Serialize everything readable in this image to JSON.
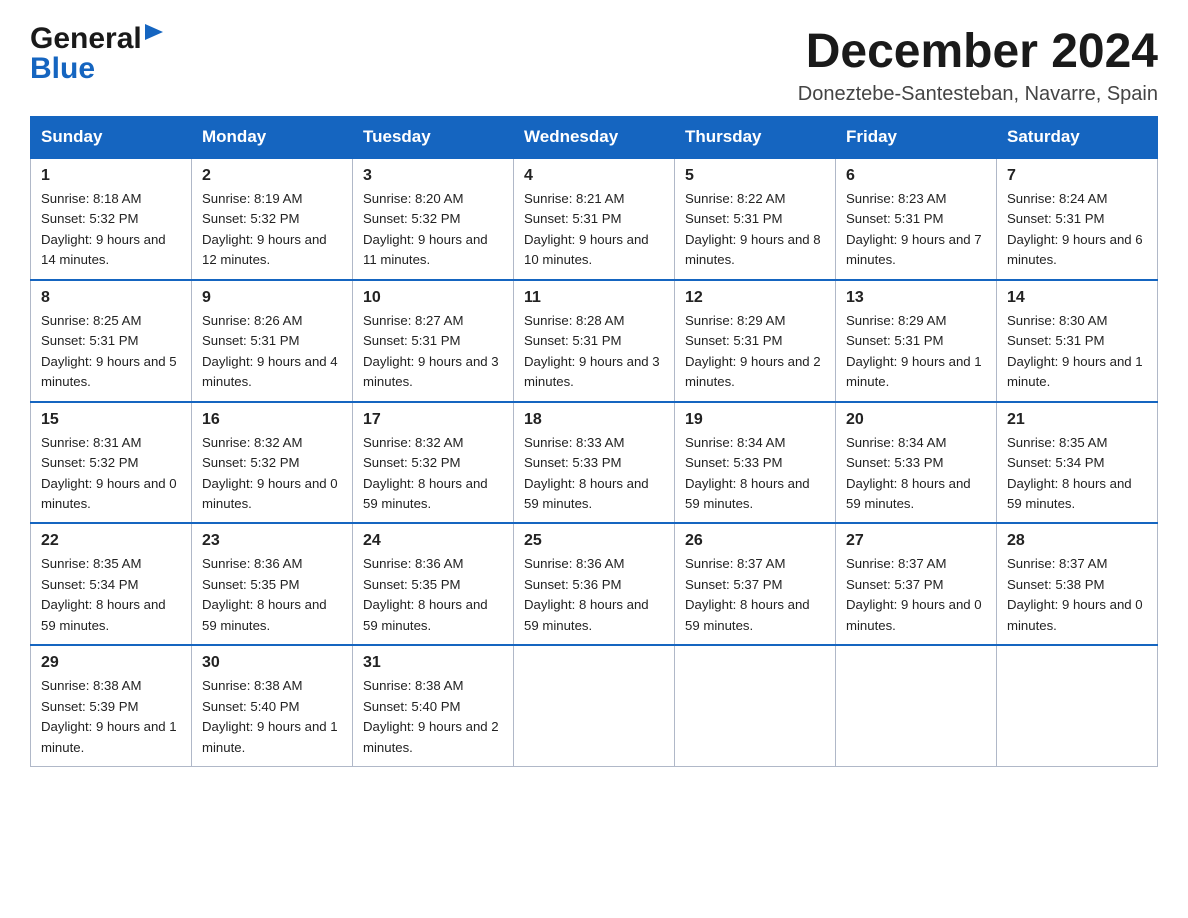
{
  "logo": {
    "general": "General",
    "blue": "Blue"
  },
  "header": {
    "month_year": "December 2024",
    "location": "Doneztebe-Santesteban, Navarre, Spain"
  },
  "days_of_week": [
    "Sunday",
    "Monday",
    "Tuesday",
    "Wednesday",
    "Thursday",
    "Friday",
    "Saturday"
  ],
  "weeks": [
    [
      {
        "day": "1",
        "sunrise": "8:18 AM",
        "sunset": "5:32 PM",
        "daylight": "9 hours and 14 minutes."
      },
      {
        "day": "2",
        "sunrise": "8:19 AM",
        "sunset": "5:32 PM",
        "daylight": "9 hours and 12 minutes."
      },
      {
        "day": "3",
        "sunrise": "8:20 AM",
        "sunset": "5:32 PM",
        "daylight": "9 hours and 11 minutes."
      },
      {
        "day": "4",
        "sunrise": "8:21 AM",
        "sunset": "5:31 PM",
        "daylight": "9 hours and 10 minutes."
      },
      {
        "day": "5",
        "sunrise": "8:22 AM",
        "sunset": "5:31 PM",
        "daylight": "9 hours and 8 minutes."
      },
      {
        "day": "6",
        "sunrise": "8:23 AM",
        "sunset": "5:31 PM",
        "daylight": "9 hours and 7 minutes."
      },
      {
        "day": "7",
        "sunrise": "8:24 AM",
        "sunset": "5:31 PM",
        "daylight": "9 hours and 6 minutes."
      }
    ],
    [
      {
        "day": "8",
        "sunrise": "8:25 AM",
        "sunset": "5:31 PM",
        "daylight": "9 hours and 5 minutes."
      },
      {
        "day": "9",
        "sunrise": "8:26 AM",
        "sunset": "5:31 PM",
        "daylight": "9 hours and 4 minutes."
      },
      {
        "day": "10",
        "sunrise": "8:27 AM",
        "sunset": "5:31 PM",
        "daylight": "9 hours and 3 minutes."
      },
      {
        "day": "11",
        "sunrise": "8:28 AM",
        "sunset": "5:31 PM",
        "daylight": "9 hours and 3 minutes."
      },
      {
        "day": "12",
        "sunrise": "8:29 AM",
        "sunset": "5:31 PM",
        "daylight": "9 hours and 2 minutes."
      },
      {
        "day": "13",
        "sunrise": "8:29 AM",
        "sunset": "5:31 PM",
        "daylight": "9 hours and 1 minute."
      },
      {
        "day": "14",
        "sunrise": "8:30 AM",
        "sunset": "5:31 PM",
        "daylight": "9 hours and 1 minute."
      }
    ],
    [
      {
        "day": "15",
        "sunrise": "8:31 AM",
        "sunset": "5:32 PM",
        "daylight": "9 hours and 0 minutes."
      },
      {
        "day": "16",
        "sunrise": "8:32 AM",
        "sunset": "5:32 PM",
        "daylight": "9 hours and 0 minutes."
      },
      {
        "day": "17",
        "sunrise": "8:32 AM",
        "sunset": "5:32 PM",
        "daylight": "8 hours and 59 minutes."
      },
      {
        "day": "18",
        "sunrise": "8:33 AM",
        "sunset": "5:33 PM",
        "daylight": "8 hours and 59 minutes."
      },
      {
        "day": "19",
        "sunrise": "8:34 AM",
        "sunset": "5:33 PM",
        "daylight": "8 hours and 59 minutes."
      },
      {
        "day": "20",
        "sunrise": "8:34 AM",
        "sunset": "5:33 PM",
        "daylight": "8 hours and 59 minutes."
      },
      {
        "day": "21",
        "sunrise": "8:35 AM",
        "sunset": "5:34 PM",
        "daylight": "8 hours and 59 minutes."
      }
    ],
    [
      {
        "day": "22",
        "sunrise": "8:35 AM",
        "sunset": "5:34 PM",
        "daylight": "8 hours and 59 minutes."
      },
      {
        "day": "23",
        "sunrise": "8:36 AM",
        "sunset": "5:35 PM",
        "daylight": "8 hours and 59 minutes."
      },
      {
        "day": "24",
        "sunrise": "8:36 AM",
        "sunset": "5:35 PM",
        "daylight": "8 hours and 59 minutes."
      },
      {
        "day": "25",
        "sunrise": "8:36 AM",
        "sunset": "5:36 PM",
        "daylight": "8 hours and 59 minutes."
      },
      {
        "day": "26",
        "sunrise": "8:37 AM",
        "sunset": "5:37 PM",
        "daylight": "8 hours and 59 minutes."
      },
      {
        "day": "27",
        "sunrise": "8:37 AM",
        "sunset": "5:37 PM",
        "daylight": "9 hours and 0 minutes."
      },
      {
        "day": "28",
        "sunrise": "8:37 AM",
        "sunset": "5:38 PM",
        "daylight": "9 hours and 0 minutes."
      }
    ],
    [
      {
        "day": "29",
        "sunrise": "8:38 AM",
        "sunset": "5:39 PM",
        "daylight": "9 hours and 1 minute."
      },
      {
        "day": "30",
        "sunrise": "8:38 AM",
        "sunset": "5:40 PM",
        "daylight": "9 hours and 1 minute."
      },
      {
        "day": "31",
        "sunrise": "8:38 AM",
        "sunset": "5:40 PM",
        "daylight": "9 hours and 2 minutes."
      },
      null,
      null,
      null,
      null
    ]
  ],
  "colors": {
    "header_bg": "#1565c0",
    "header_text": "#ffffff",
    "border": "#b0b8c8",
    "accent": "#1565c0"
  }
}
